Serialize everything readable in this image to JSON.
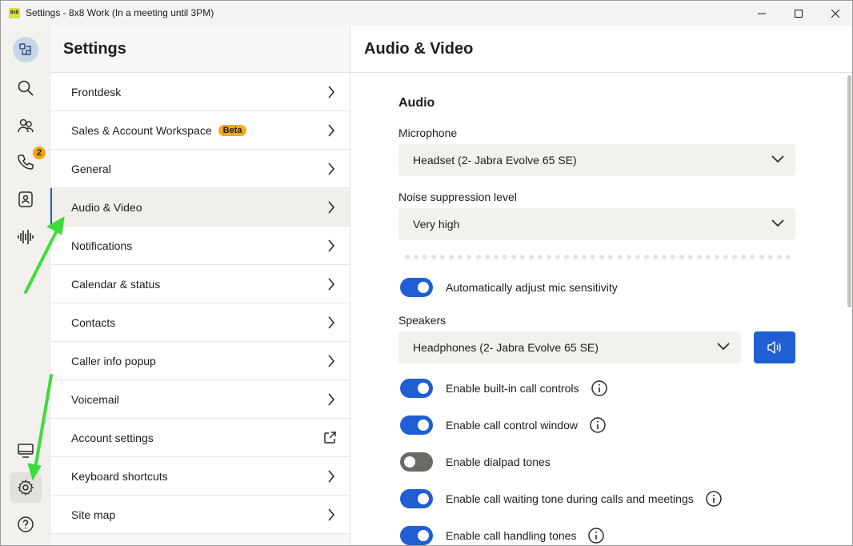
{
  "window": {
    "logo_text": "8x8",
    "title": "Settings - 8x8 Work (In a meeting until 3PM)"
  },
  "rail": {
    "items": [
      {
        "name": "home-icon"
      },
      {
        "name": "search-icon"
      },
      {
        "name": "contacts-icon"
      },
      {
        "name": "phone-icon",
        "badge": "2"
      },
      {
        "name": "directory-icon"
      },
      {
        "name": "voice-activity-icon"
      },
      {
        "name": "desktop-icon"
      },
      {
        "name": "settings-icon"
      },
      {
        "name": "help-icon"
      }
    ]
  },
  "settings_nav": {
    "title": "Settings",
    "items": [
      {
        "label": "Frontdesk"
      },
      {
        "label": "Sales & Account Workspace",
        "badge": "Beta"
      },
      {
        "label": "General"
      },
      {
        "label": "Audio & Video",
        "active": true
      },
      {
        "label": "Notifications"
      },
      {
        "label": "Calendar & status"
      },
      {
        "label": "Contacts"
      },
      {
        "label": "Caller info popup"
      },
      {
        "label": "Voicemail"
      },
      {
        "label": "Account settings",
        "icon": "external-link-icon"
      },
      {
        "label": "Keyboard shortcuts"
      },
      {
        "label": "Site map"
      }
    ]
  },
  "content": {
    "title": "Audio & Video",
    "audio_section": "Audio",
    "microphone": {
      "label": "Microphone",
      "value": "Headset (2- Jabra Evolve 65 SE)"
    },
    "noise": {
      "label": "Noise suppression level",
      "value": "Very high"
    },
    "auto_adjust": {
      "label": "Automatically adjust mic sensitivity",
      "on": true
    },
    "speakers": {
      "label": "Speakers",
      "value": "Headphones (2- Jabra Evolve 65 SE)"
    },
    "toggles": [
      {
        "label": "Enable built-in call controls",
        "on": true,
        "info": true
      },
      {
        "label": "Enable call control window",
        "on": true,
        "info": true
      },
      {
        "label": "Enable dialpad tones",
        "on": false,
        "info": false
      },
      {
        "label": "Enable call waiting tone during calls and meetings",
        "on": true,
        "info": true
      },
      {
        "label": "Enable call handling tones",
        "on": true,
        "info": true
      }
    ]
  },
  "colors": {
    "accent": "#1f5fd3",
    "badge": "#f5a91e",
    "annotation_arrow": "#3ddc3d"
  }
}
